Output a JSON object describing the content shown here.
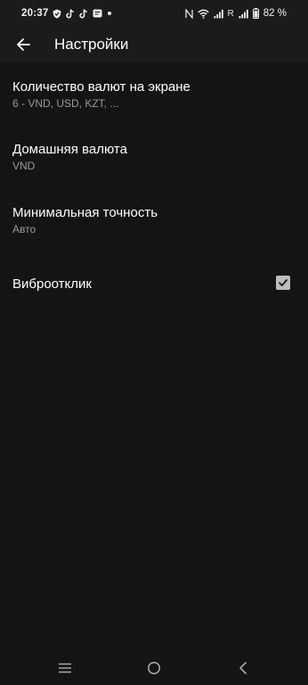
{
  "status_bar": {
    "time": "20:37",
    "left_icons": [
      "shield-icon",
      "tiktok-icon",
      "tiktok-icon",
      "message-icon",
      "dot-icon"
    ],
    "right_icons": [
      "nfc-icon",
      "wifi-icon",
      "signal-icon",
      "signal-icon",
      "battery-icon"
    ],
    "roaming": "R",
    "battery": "82 %"
  },
  "app_bar": {
    "title": "Настройки",
    "back_icon": "arrow-left-icon"
  },
  "preferences": [
    {
      "title": "Количество валют на экране",
      "summary": "6 - VND, USD, KZT, ..."
    },
    {
      "title": "Домашняя валюта",
      "summary": "VND"
    },
    {
      "title": "Минимальная точность",
      "summary": "Авто"
    },
    {
      "title": "Виброотклик",
      "checked": true
    }
  ],
  "nav_bar": {
    "icons": [
      "menu-icon",
      "home-icon",
      "back-icon"
    ]
  },
  "colors": {
    "background": "#141414",
    "bar": "#1b1b1b",
    "text_primary": "#ffffff",
    "text_secondary": "#9a9a9a",
    "checkbox": "#bdbdbd"
  }
}
